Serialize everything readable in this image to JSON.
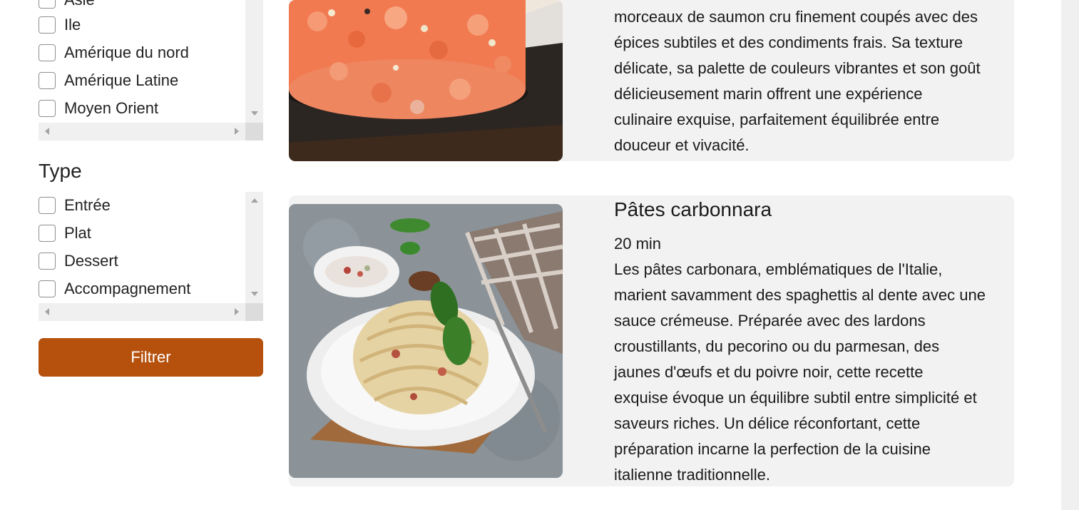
{
  "sidebar": {
    "origin_filter": {
      "items": [
        "Asie",
        "Ile",
        "Amérique du nord",
        "Amérique Latine",
        "Moyen Orient"
      ]
    },
    "type_filter": {
      "title": "Type",
      "items": [
        "Entrée",
        "Plat",
        "Dessert",
        "Accompagnement"
      ]
    },
    "filter_button_label": "Filtrer"
  },
  "recipes": [
    {
      "description_lines": [
        "morceaux de saumon cru finement coupés avec des",
        "épices subtiles et des condiments frais. Sa texture",
        "délicate, sa palette de couleurs vibrantes et son goût",
        "délicieusement marin offrent une expérience",
        "culinaire exquise, parfaitement équilibrée entre",
        "douceur et vivacité."
      ]
    },
    {
      "title": "Pâtes carbonnara",
      "time": "20 min",
      "description_lines": [
        "Les pâtes carbonara, emblématiques de l'Italie,",
        "marient savamment des spaghettis al dente avec une",
        "sauce crémeuse. Préparée avec des lardons",
        "croustillants, du pecorino ou du parmesan, des",
        "jaunes d'œufs et du poivre noir, cette recette",
        "exquise évoque un équilibre subtil entre simplicité et",
        "saveurs riches. Un délice réconfortant, cette",
        "préparation incarne la perfection de la cuisine",
        "italienne traditionnelle."
      ]
    }
  ],
  "colors": {
    "accent": "#b5510d",
    "card_background": "#f2f2f2"
  }
}
